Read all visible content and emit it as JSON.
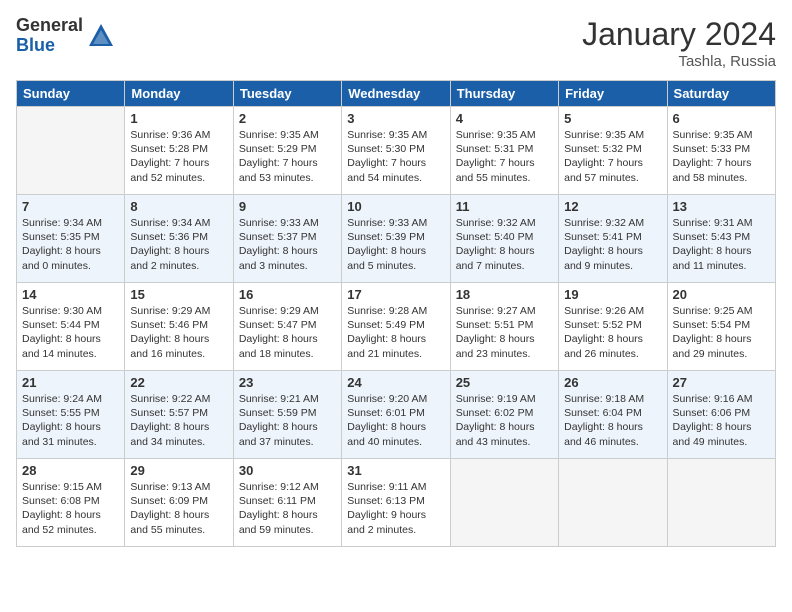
{
  "logo": {
    "general": "General",
    "blue": "Blue"
  },
  "title": "January 2024",
  "location": "Tashla, Russia",
  "days_header": [
    "Sunday",
    "Monday",
    "Tuesday",
    "Wednesday",
    "Thursday",
    "Friday",
    "Saturday"
  ],
  "weeks": [
    [
      {
        "day": "",
        "info": ""
      },
      {
        "day": "1",
        "info": "Sunrise: 9:36 AM\nSunset: 5:28 PM\nDaylight: 7 hours\nand 52 minutes."
      },
      {
        "day": "2",
        "info": "Sunrise: 9:35 AM\nSunset: 5:29 PM\nDaylight: 7 hours\nand 53 minutes."
      },
      {
        "day": "3",
        "info": "Sunrise: 9:35 AM\nSunset: 5:30 PM\nDaylight: 7 hours\nand 54 minutes."
      },
      {
        "day": "4",
        "info": "Sunrise: 9:35 AM\nSunset: 5:31 PM\nDaylight: 7 hours\nand 55 minutes."
      },
      {
        "day": "5",
        "info": "Sunrise: 9:35 AM\nSunset: 5:32 PM\nDaylight: 7 hours\nand 57 minutes."
      },
      {
        "day": "6",
        "info": "Sunrise: 9:35 AM\nSunset: 5:33 PM\nDaylight: 7 hours\nand 58 minutes."
      }
    ],
    [
      {
        "day": "7",
        "info": "Sunrise: 9:34 AM\nSunset: 5:35 PM\nDaylight: 8 hours\nand 0 minutes."
      },
      {
        "day": "8",
        "info": "Sunrise: 9:34 AM\nSunset: 5:36 PM\nDaylight: 8 hours\nand 2 minutes."
      },
      {
        "day": "9",
        "info": "Sunrise: 9:33 AM\nSunset: 5:37 PM\nDaylight: 8 hours\nand 3 minutes."
      },
      {
        "day": "10",
        "info": "Sunrise: 9:33 AM\nSunset: 5:39 PM\nDaylight: 8 hours\nand 5 minutes."
      },
      {
        "day": "11",
        "info": "Sunrise: 9:32 AM\nSunset: 5:40 PM\nDaylight: 8 hours\nand 7 minutes."
      },
      {
        "day": "12",
        "info": "Sunrise: 9:32 AM\nSunset: 5:41 PM\nDaylight: 8 hours\nand 9 minutes."
      },
      {
        "day": "13",
        "info": "Sunrise: 9:31 AM\nSunset: 5:43 PM\nDaylight: 8 hours\nand 11 minutes."
      }
    ],
    [
      {
        "day": "14",
        "info": "Sunrise: 9:30 AM\nSunset: 5:44 PM\nDaylight: 8 hours\nand 14 minutes."
      },
      {
        "day": "15",
        "info": "Sunrise: 9:29 AM\nSunset: 5:46 PM\nDaylight: 8 hours\nand 16 minutes."
      },
      {
        "day": "16",
        "info": "Sunrise: 9:29 AM\nSunset: 5:47 PM\nDaylight: 8 hours\nand 18 minutes."
      },
      {
        "day": "17",
        "info": "Sunrise: 9:28 AM\nSunset: 5:49 PM\nDaylight: 8 hours\nand 21 minutes."
      },
      {
        "day": "18",
        "info": "Sunrise: 9:27 AM\nSunset: 5:51 PM\nDaylight: 8 hours\nand 23 minutes."
      },
      {
        "day": "19",
        "info": "Sunrise: 9:26 AM\nSunset: 5:52 PM\nDaylight: 8 hours\nand 26 minutes."
      },
      {
        "day": "20",
        "info": "Sunrise: 9:25 AM\nSunset: 5:54 PM\nDaylight: 8 hours\nand 29 minutes."
      }
    ],
    [
      {
        "day": "21",
        "info": "Sunrise: 9:24 AM\nSunset: 5:55 PM\nDaylight: 8 hours\nand 31 minutes."
      },
      {
        "day": "22",
        "info": "Sunrise: 9:22 AM\nSunset: 5:57 PM\nDaylight: 8 hours\nand 34 minutes."
      },
      {
        "day": "23",
        "info": "Sunrise: 9:21 AM\nSunset: 5:59 PM\nDaylight: 8 hours\nand 37 minutes."
      },
      {
        "day": "24",
        "info": "Sunrise: 9:20 AM\nSunset: 6:01 PM\nDaylight: 8 hours\nand 40 minutes."
      },
      {
        "day": "25",
        "info": "Sunrise: 9:19 AM\nSunset: 6:02 PM\nDaylight: 8 hours\nand 43 minutes."
      },
      {
        "day": "26",
        "info": "Sunrise: 9:18 AM\nSunset: 6:04 PM\nDaylight: 8 hours\nand 46 minutes."
      },
      {
        "day": "27",
        "info": "Sunrise: 9:16 AM\nSunset: 6:06 PM\nDaylight: 8 hours\nand 49 minutes."
      }
    ],
    [
      {
        "day": "28",
        "info": "Sunrise: 9:15 AM\nSunset: 6:08 PM\nDaylight: 8 hours\nand 52 minutes."
      },
      {
        "day": "29",
        "info": "Sunrise: 9:13 AM\nSunset: 6:09 PM\nDaylight: 8 hours\nand 55 minutes."
      },
      {
        "day": "30",
        "info": "Sunrise: 9:12 AM\nSunset: 6:11 PM\nDaylight: 8 hours\nand 59 minutes."
      },
      {
        "day": "31",
        "info": "Sunrise: 9:11 AM\nSunset: 6:13 PM\nDaylight: 9 hours\nand 2 minutes."
      },
      {
        "day": "",
        "info": ""
      },
      {
        "day": "",
        "info": ""
      },
      {
        "day": "",
        "info": ""
      }
    ]
  ]
}
